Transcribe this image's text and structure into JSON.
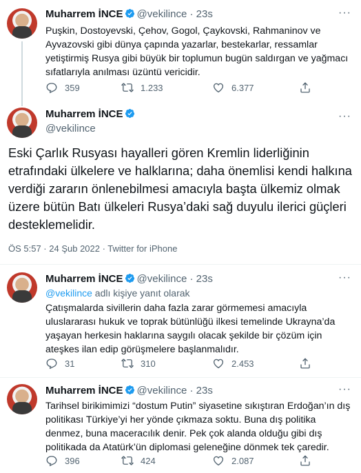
{
  "tweet1": {
    "name": "Muharrem İNCE",
    "handle": "@vekilince",
    "time": "23s",
    "text": "Puşkin, Dostoyevski, Çehov, Gogol, Çaykovski, Rahmaninov ve Ayvazovski gibi dünya çapında yazarlar, bestekarlar, ressamlar yetiştirmiş Rusya gibi büyük bir toplumun bugün saldırgan ve yağmacı sıfatlarıyla anılması üzüntü vericidir.",
    "replies": "359",
    "retweets": "1.233",
    "likes": "6.377"
  },
  "main": {
    "name": "Muharrem İNCE",
    "handle": "@vekilince",
    "text": "Eski Çarlık Rusyası hayalleri gören Kremlin liderliğinin etrafındaki ülkelere ve halklarına; daha önemlisi kendi halkına verdiği zararın önlenebilmesi amacıyla başta ülkemiz olmak üzere bütün Batı ülkeleri Rusya’daki sağ duyulu ilerici güçleri desteklemelidir.",
    "timestamp": "ÖS 5:57 · 24 Şub 2022 · Twitter for iPhone"
  },
  "tweet3": {
    "name": "Muharrem İNCE",
    "handle": "@vekilince",
    "time": "23s",
    "reply_mention": "@vekilince",
    "reply_suffix": " adlı kişiye yanıt olarak",
    "text": "Çatışmalarda sivillerin daha fazla zarar görmemesi amacıyla uluslararası hukuk ve toprak bütünlüğü ilkesi temelinde Ukrayna’da yaşayan herkesin haklarına saygılı olacak şekilde bir çözüm için ateşkes ilan edip görüşmelere başlanmalıdır.",
    "replies": "31",
    "retweets": "310",
    "likes": "2.453"
  },
  "tweet4": {
    "name": "Muharrem İNCE",
    "handle": "@vekilince",
    "time": "23s",
    "text": "Tarihsel birikimimizi “dostum Putin” siyasetine sıkıştıran Erdoğan’ın dış politikası Türkiye’yi her yönde çıkmaza soktu. Buna dış politika denmez, buna maceracılık denir. Pek çok alanda olduğu gibi dış politikada da Atatürk’ün diplomasi geleneğine dönmek tek çaredir.",
    "replies": "396",
    "retweets": "424",
    "likes": "2.087"
  },
  "colors": {
    "accent": "#1d9bf0",
    "secondary_text": "#536471",
    "divider": "#eff3f4"
  },
  "icons": [
    "verified-badge-icon",
    "reply-icon",
    "retweet-icon",
    "like-icon",
    "share-icon",
    "more-icon"
  ]
}
